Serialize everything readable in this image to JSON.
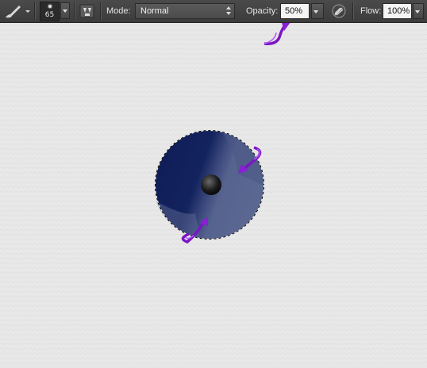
{
  "options_bar": {
    "tool_icon": "brush-icon",
    "brush_size": "65",
    "panel_icon": "brush-panel-icon",
    "mode_label": "Mode:",
    "mode_value": "Normal",
    "opacity_label": "Opacity:",
    "opacity_value": "50%",
    "airbrush_icon": "airbrush-icon",
    "flow_label": "Flow:",
    "flow_value": "100%"
  },
  "canvas": {
    "background": "#e8e8e8",
    "selection": "circular-marching-ants",
    "disc_colors": {
      "dark": "#0f1d55",
      "light": "#56638e",
      "center": "#1a1a1a"
    },
    "annotation_color": "#8b1fd6"
  }
}
